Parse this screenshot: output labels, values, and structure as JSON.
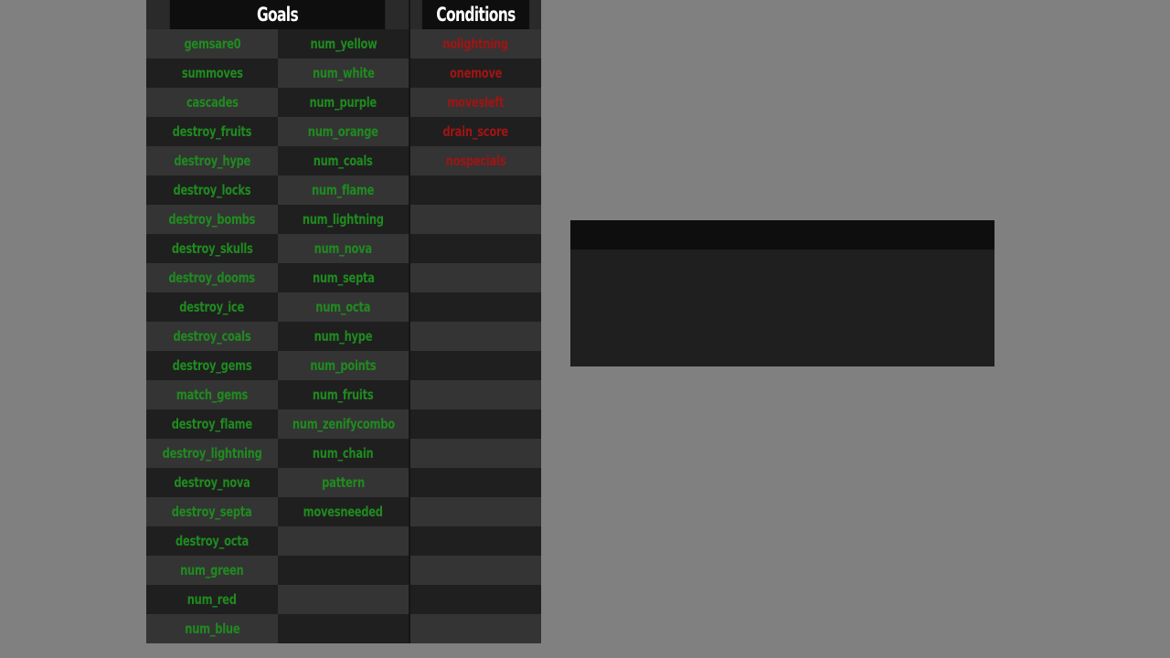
{
  "goals": {
    "title": "Goals",
    "column1": [
      "gemsare0",
      "summoves",
      "cascades",
      "destroy_fruits",
      "destroy_hype",
      "destroy_locks",
      "destroy_bombs",
      "destroy_skulls",
      "destroy_dooms",
      "destroy_ice",
      "destroy_coals",
      "destroy_gems",
      "match_gems",
      "destroy_flame",
      "destroy_lightning",
      "destroy_nova",
      "destroy_septa",
      "destroy_octa",
      "num_green",
      "num_red",
      "num_blue"
    ],
    "column2": [
      "num_yellow",
      "num_white",
      "num_purple",
      "num_orange",
      "num_coals",
      "num_flame",
      "num_lightning",
      "num_nova",
      "num_septa",
      "num_octa",
      "num_hype",
      "num_points",
      "num_fruits",
      "num_zenifycombo",
      "num_chain",
      "pattern",
      "movesneeded",
      "",
      "",
      "",
      ""
    ]
  },
  "conditions": {
    "title": "Conditions",
    "items": [
      "nolightning",
      "onemove",
      "movesleft",
      "drain_score",
      "nospecials",
      "",
      "",
      "",
      "",
      "",
      "",
      "",
      "",
      "",
      "",
      "",
      "",
      "",
      "",
      "",
      ""
    ]
  },
  "info_box": {
    "title": "",
    "body": ""
  },
  "colors": {
    "background": "#808080",
    "goal_text": "#1f8b1f",
    "condition_text": "#a01414",
    "header_text": "#ffffff",
    "header_bg": "#0e0e0e",
    "row_light": "#343434",
    "row_dark": "#1f1f1f"
  }
}
